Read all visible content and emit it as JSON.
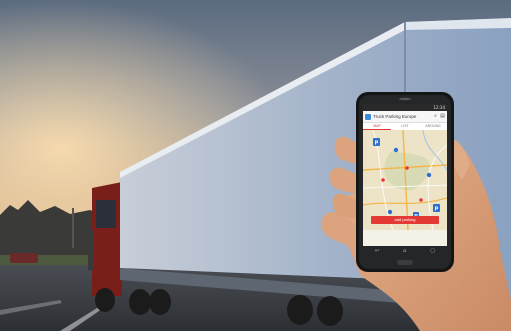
{
  "app": {
    "status_time": "12:34",
    "title": "Truck Parking Europe",
    "tabs": [
      {
        "label": "MAP",
        "active": true
      },
      {
        "label": "LIST",
        "active": false
      },
      {
        "label": "AROUND",
        "active": false
      }
    ],
    "add_button_label": "add parking"
  },
  "icons": {
    "search": "search-icon",
    "menu": "menu-icon",
    "back": "back-icon",
    "home": "home-icon",
    "recent": "recent-apps-icon",
    "parking_marker": "parking-marker-icon"
  },
  "colors": {
    "accent": "#e53935",
    "marker": "#2f6fd0"
  }
}
